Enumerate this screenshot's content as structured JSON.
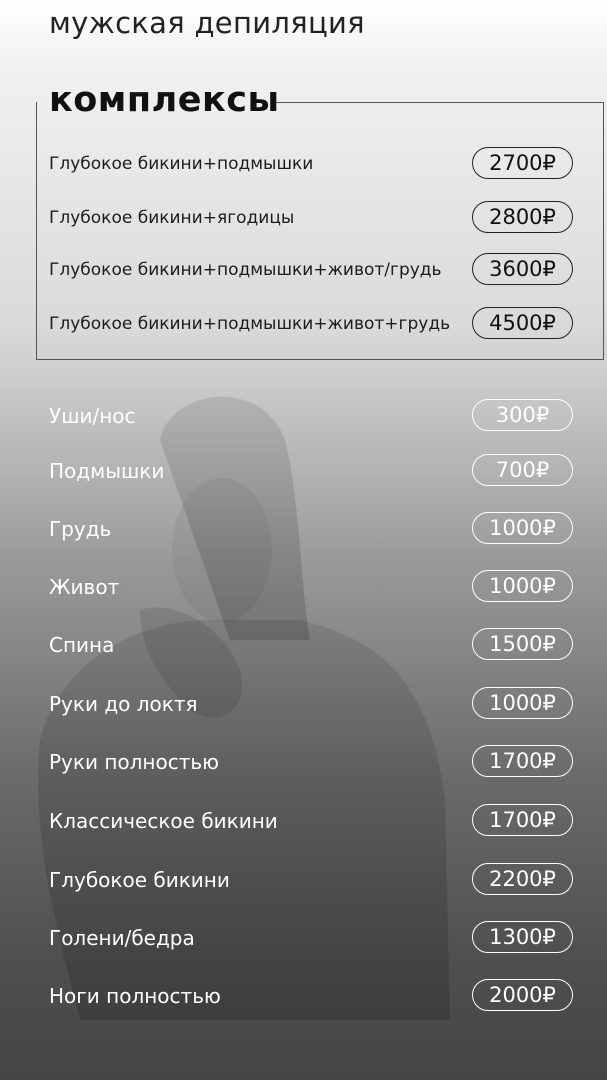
{
  "page_title": "мужская депиляция",
  "complexes": {
    "title": "комплексы",
    "items": [
      {
        "label": "Глубокое бикини+подмышки",
        "price": "2700₽"
      },
      {
        "label": "Глубокое бикини+ягодицы",
        "price": "2800₽"
      },
      {
        "label": "Глубокое бикини+подмышки+живот/грудь",
        "price": "3600₽"
      },
      {
        "label": "Глубокое бикини+подмышки+живот+грудь",
        "price": "4500₽"
      }
    ]
  },
  "services": [
    {
      "label": "Уши/нос",
      "price": "300₽"
    },
    {
      "label": "Подмышки",
      "price": "700₽"
    },
    {
      "label": "Грудь",
      "price": "1000₽"
    },
    {
      "label": "Живот",
      "price": "1000₽"
    },
    {
      "label": "Спина",
      "price": "1500₽"
    },
    {
      "label": "Руки до локтя",
      "price": "1000₽"
    },
    {
      "label": "Руки полностью",
      "price": "1700₽"
    },
    {
      "label": "Классическое бикини",
      "price": "1700₽"
    },
    {
      "label": "Глубокое бикини",
      "price": "2200₽"
    },
    {
      "label": "Голени/бедра",
      "price": "1300₽"
    },
    {
      "label": "Ноги полностью",
      "price": "2000₽"
    }
  ]
}
